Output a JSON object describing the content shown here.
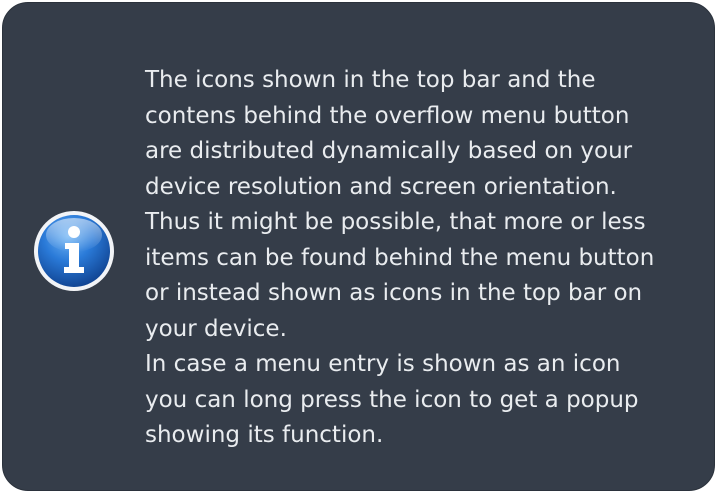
{
  "note": {
    "icon": "info-icon",
    "lines": [
      "The icons shown in the top bar and the",
      "contens behind the overflow menu button",
      "are distributed dynamically based on your",
      "device resolution and screen orientation.",
      "Thus it might be possible, that more or less",
      "items can be found behind the menu button",
      "or instead shown as icons in the top bar on",
      "your device.",
      "In case a menu entry is shown as an icon",
      "you can long press the icon to get a popup",
      "showing its function."
    ]
  },
  "colors": {
    "background": "#353d49",
    "text": "#e9ecef",
    "icon_blue": "#1f66c4"
  }
}
